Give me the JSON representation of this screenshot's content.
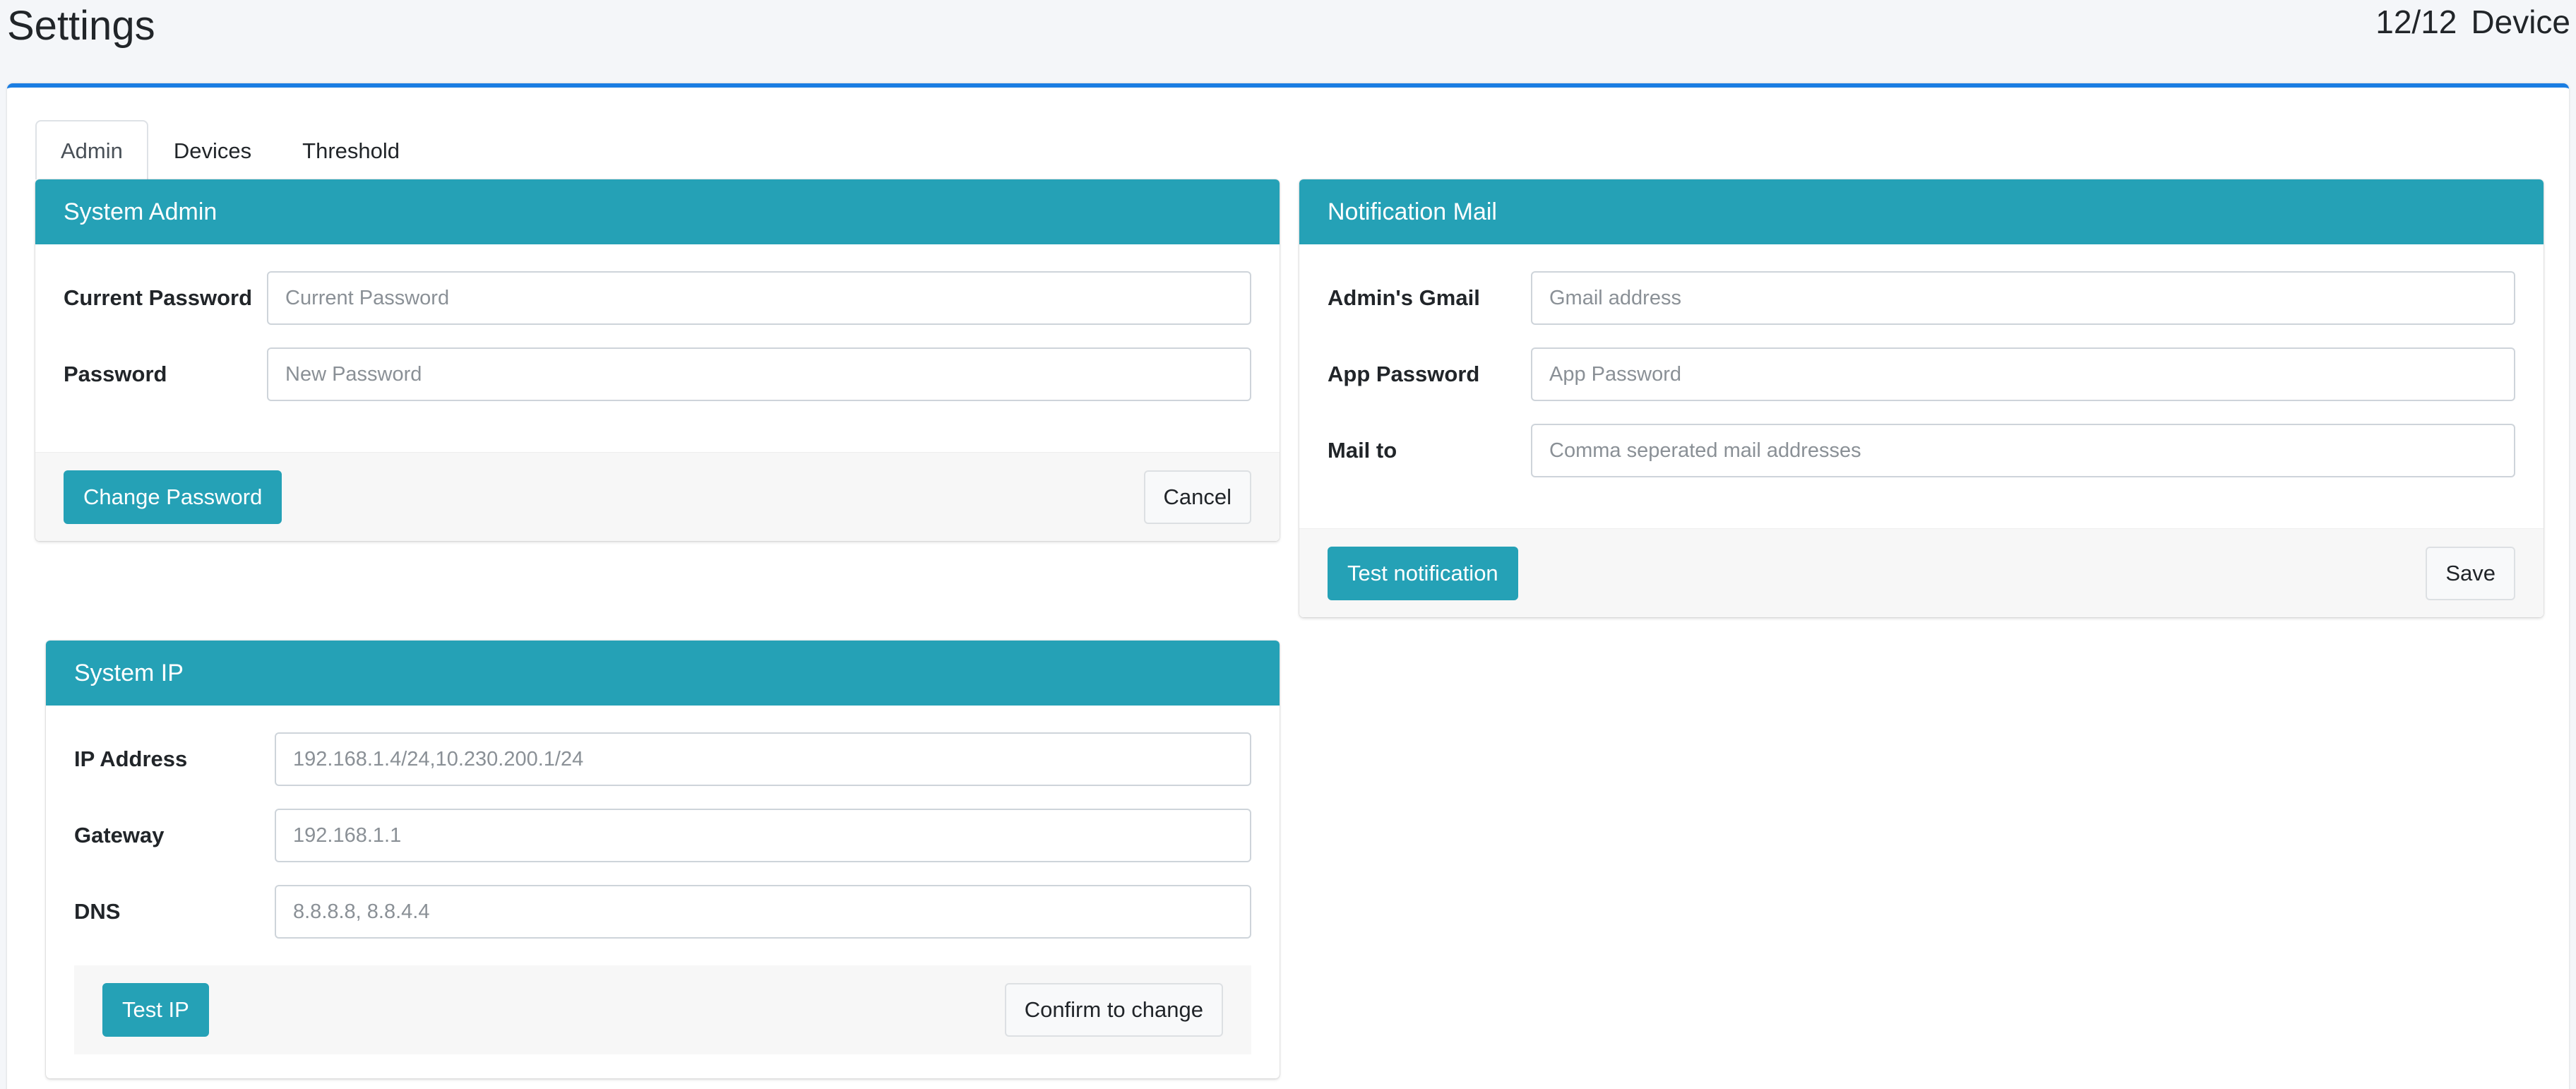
{
  "header": {
    "title": "Settings",
    "device_count": "12/12",
    "device_label": "Device"
  },
  "tabs": [
    {
      "label": "Admin",
      "active": true
    },
    {
      "label": "Devices",
      "active": false
    },
    {
      "label": "Threshold",
      "active": false
    }
  ],
  "system_admin": {
    "title": "System Admin",
    "current_password_label": "Current Password",
    "current_password_placeholder": "Current Password",
    "password_label": "Password",
    "password_placeholder": "New Password",
    "change_password_button": "Change Password",
    "cancel_button": "Cancel"
  },
  "notification_mail": {
    "title": "Notification Mail",
    "gmail_label": "Admin's Gmail",
    "gmail_placeholder": "Gmail address",
    "app_password_label": "App Password",
    "app_password_placeholder": "App Password",
    "mail_to_label": "Mail to",
    "mail_to_placeholder": "Comma seperated mail addresses",
    "test_button": "Test notification",
    "save_button": "Save"
  },
  "system_ip": {
    "title": "System IP",
    "ip_label": "IP Address",
    "ip_placeholder": "192.168.1.4/24,10.230.200.1/24",
    "gateway_label": "Gateway",
    "gateway_placeholder": "192.168.1.1",
    "dns_label": "DNS",
    "dns_placeholder": "8.8.8.8, 8.8.4.4",
    "test_button": "Test IP",
    "confirm_button": "Confirm to change"
  },
  "colors": {
    "accent": "#25a1b6",
    "top_border": "#1a7de2",
    "background": "#f4f6f9"
  }
}
